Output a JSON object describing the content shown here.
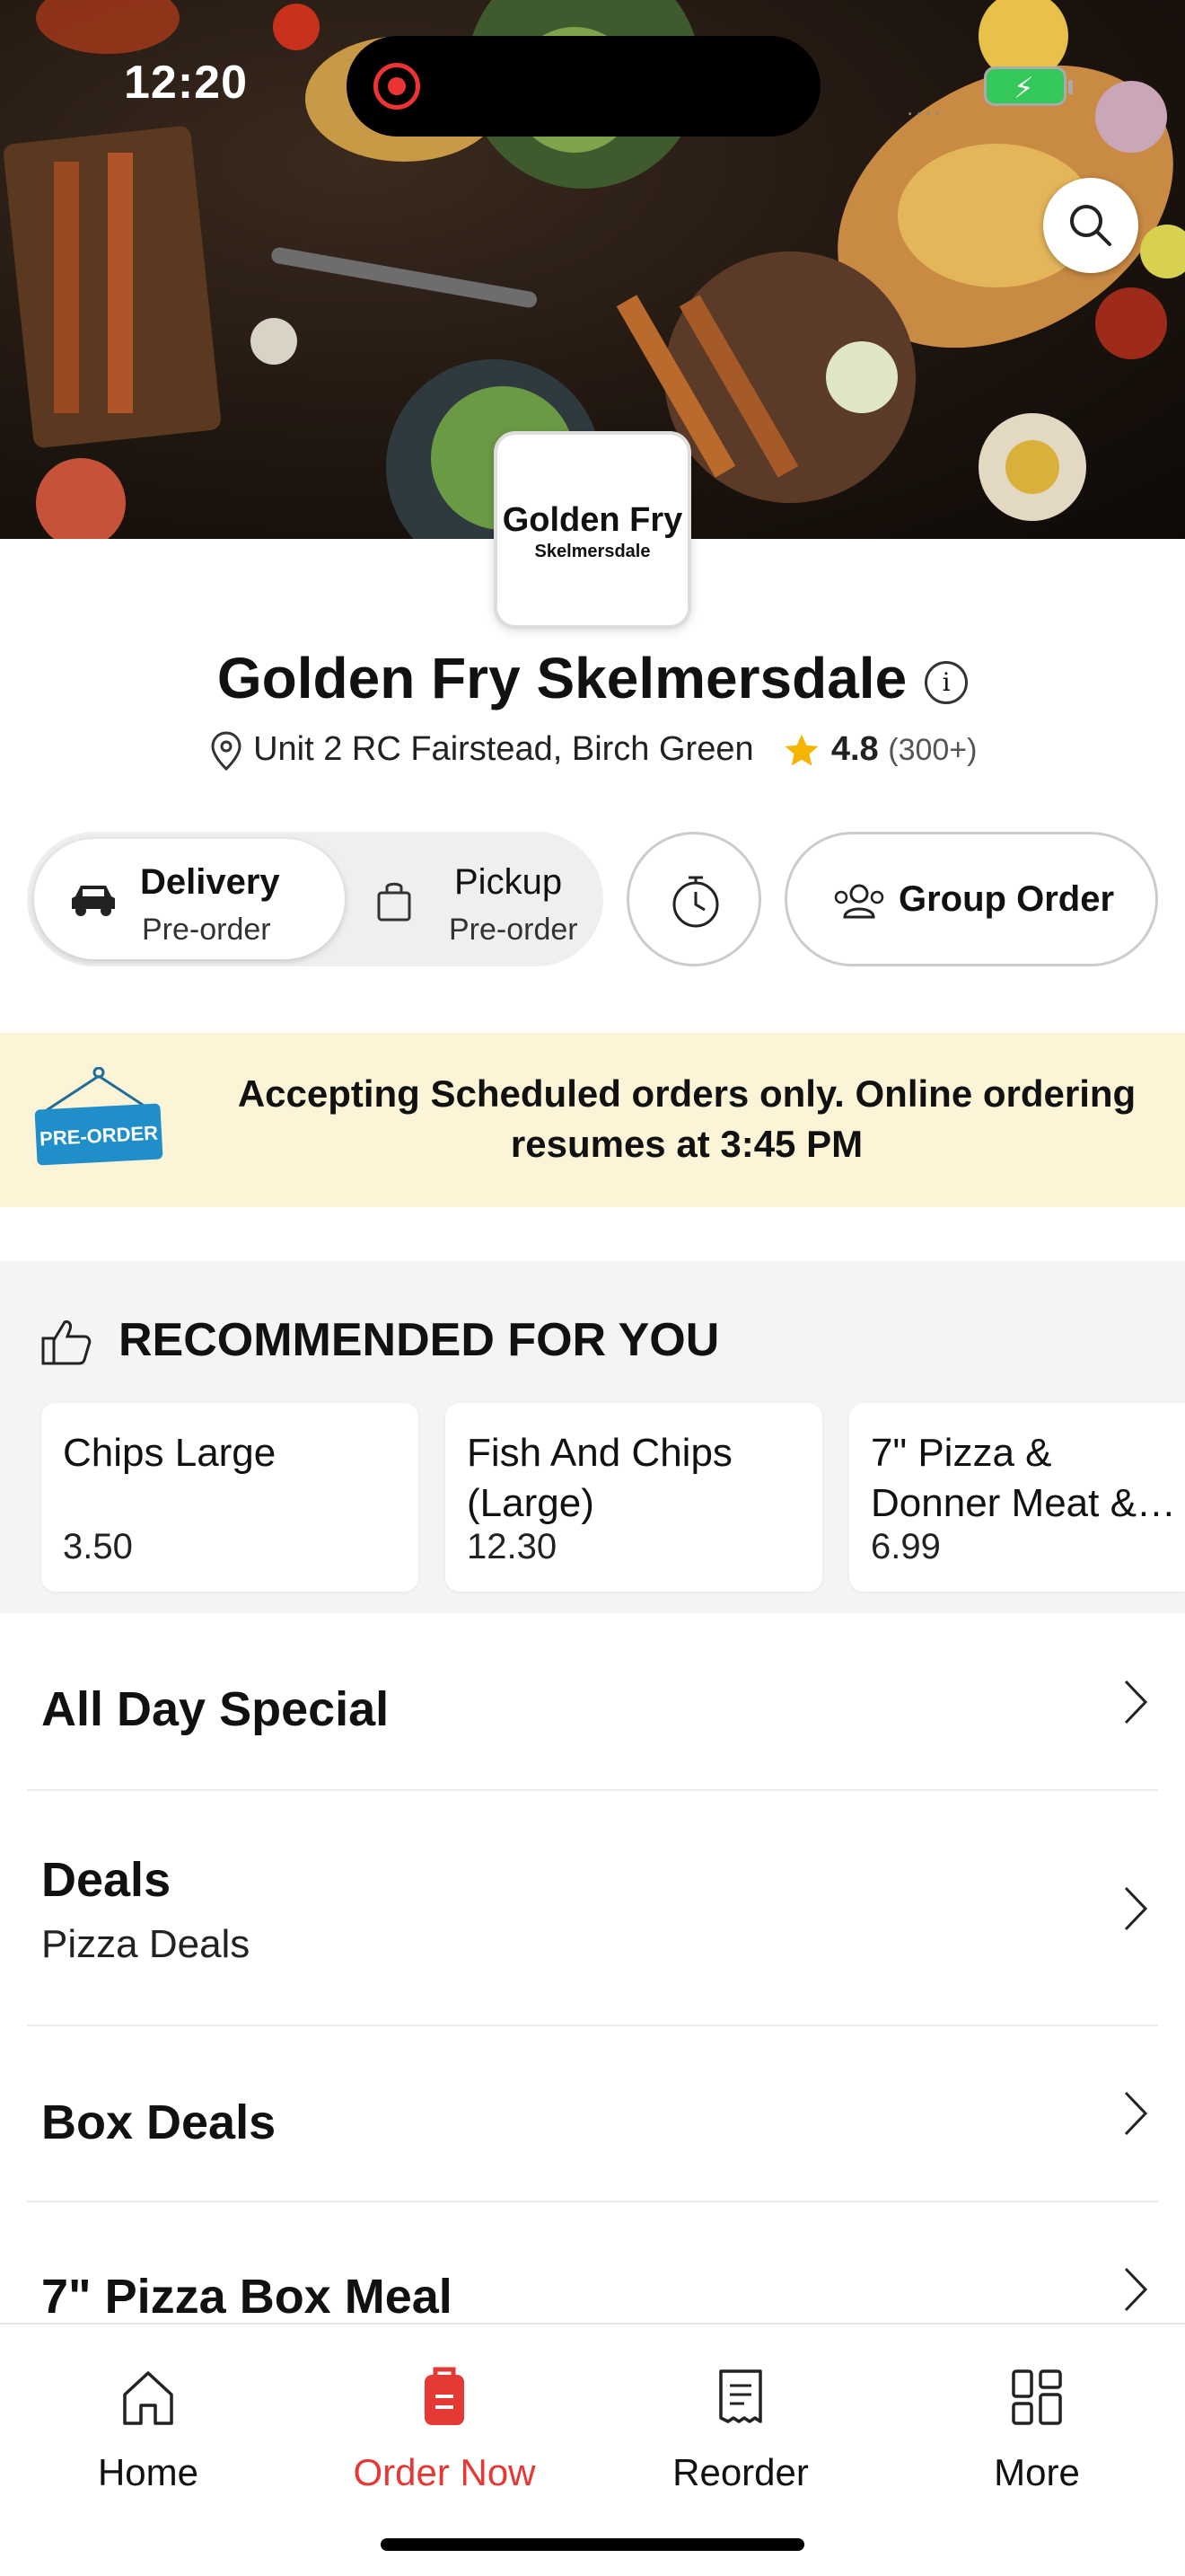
{
  "status_bar": {
    "time": "12:20",
    "signal": "....",
    "icons": [
      "screen-record-icon",
      "battery-charging-icon"
    ]
  },
  "restaurant": {
    "logo_line1": "Golden Fry",
    "logo_line2": "Skelmersdale",
    "name": "Golden Fry Skelmersdale",
    "info_glyph": "i",
    "address": "Unit 2 RC Fairstead, Birch Green",
    "rating": "4.8",
    "rating_count": "(300+)"
  },
  "order_mode": {
    "delivery_label": "Delivery",
    "delivery_sub": "Pre-order",
    "pickup_label": "Pickup",
    "pickup_sub": "Pre-order",
    "selected": "Delivery",
    "group_order_label": "Group Order"
  },
  "banner": {
    "sign_text": "PRE-ORDER",
    "message": "Accepting Scheduled orders only. Online ordering resumes at 3:45 PM"
  },
  "recommended": {
    "title": "RECOMMENDED FOR YOU",
    "items": [
      {
        "name": "Chips Large",
        "price": "3.50"
      },
      {
        "name": "Fish And Chips (Large)",
        "price": "12.30"
      },
      {
        "name": "7\" Pizza & Donner Meat &…",
        "price": "6.99"
      }
    ]
  },
  "categories": [
    {
      "name": "All Day Special",
      "subtitle": ""
    },
    {
      "name": "Deals",
      "subtitle": "Pizza Deals"
    },
    {
      "name": "Box Deals",
      "subtitle": ""
    },
    {
      "name": "7\" Pizza Box Meal",
      "subtitle": ""
    }
  ],
  "bottom_nav": {
    "items": [
      {
        "label": "Home",
        "icon": "home-icon"
      },
      {
        "label": "Order Now",
        "icon": "order-bag-icon"
      },
      {
        "label": "Reorder",
        "icon": "receipt-icon"
      },
      {
        "label": "More",
        "icon": "grid-icon"
      }
    ],
    "active": "Order Now"
  },
  "colors": {
    "accent_red": "#e53935",
    "banner_bg": "#fcf4d6",
    "section_bg": "#f4f4f4",
    "star": "#f5b400",
    "sign_blue": "#1f8ec9"
  }
}
